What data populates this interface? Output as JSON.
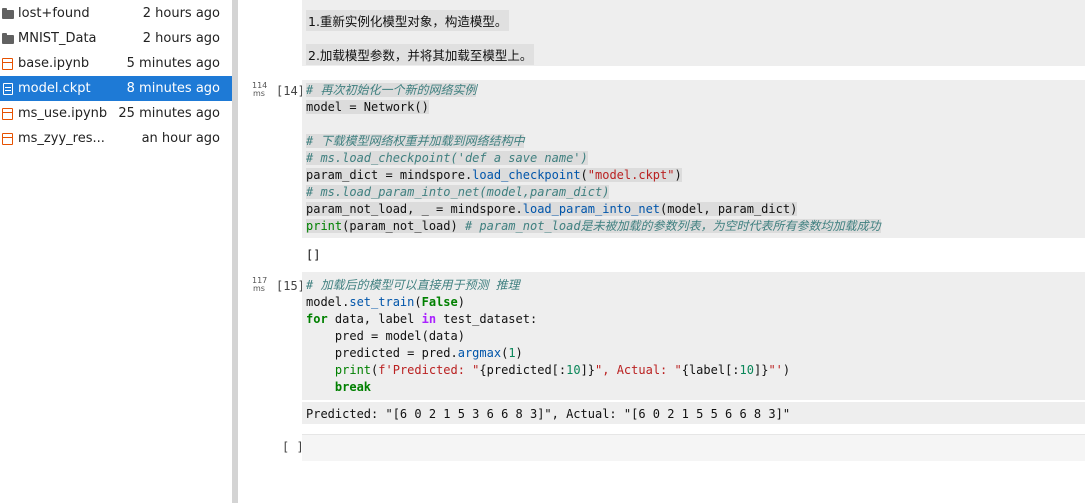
{
  "files": [
    {
      "name": "lost+found",
      "time": "2 hours ago",
      "type": "folder",
      "selected": false
    },
    {
      "name": "MNIST_Data",
      "time": "2 hours ago",
      "type": "folder",
      "selected": false
    },
    {
      "name": "base.ipynb",
      "time": "5 minutes ago",
      "type": "notebook",
      "selected": false
    },
    {
      "name": "model.ckpt",
      "time": "8 minutes ago",
      "type": "file",
      "selected": true
    },
    {
      "name": "ms_use.ipynb",
      "time": "25 minutes ago",
      "type": "notebook",
      "selected": false
    },
    {
      "name": "ms_zyy_res...",
      "time": "an hour ago",
      "type": "notebook",
      "selected": false
    }
  ],
  "markdown": {
    "line1": "1.重新实例化模型对象，构造模型。",
    "line2": "2.加载模型参数，并将其加载至模型上。"
  },
  "cell14": {
    "exec_time_value": "114",
    "exec_time_unit": "ms",
    "prompt": "[14]",
    "output": "[]"
  },
  "cell15": {
    "exec_time_value": "117",
    "exec_time_unit": "ms",
    "prompt": "[15]",
    "output": "Predicted: \"[6 0 2 1 5 3 6 6 8 3]\", Actual: \"[6 0 2 1 5 5 6 6 8 3]\""
  },
  "empty_cell": {
    "prompt": "[ ]"
  },
  "colors": {
    "selection": "#1e7ad6",
    "notebook_icon": "#e65100",
    "comment": "#408080",
    "string": "#ba2121",
    "keyword": "#008000"
  }
}
